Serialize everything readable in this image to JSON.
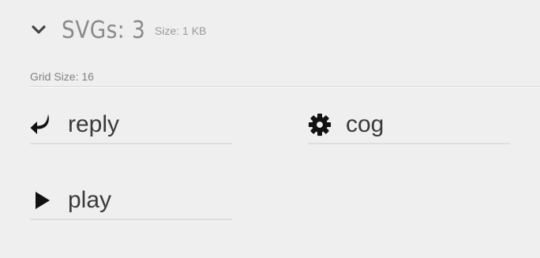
{
  "header": {
    "title": "SVGs: 3",
    "size": "Size: 1 KB",
    "chevron_icon": "chevron-down-icon"
  },
  "grid": {
    "label": "Grid Size: 16"
  },
  "icons": [
    {
      "label": "reply",
      "icon": "reply-icon"
    },
    {
      "label": "cog",
      "icon": "cog-icon"
    },
    {
      "label": "play",
      "icon": "play-icon"
    }
  ]
}
